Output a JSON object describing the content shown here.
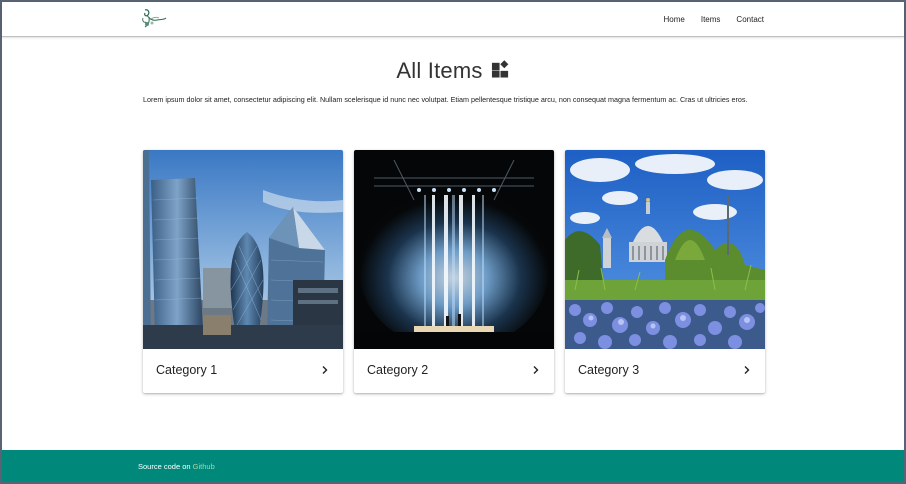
{
  "colors": {
    "footer_bg": "#00897b",
    "link": "#a5d6a7",
    "text": "#222222",
    "border": "#5a6275"
  },
  "header": {
    "logo_icon": "leaf-logo-icon",
    "nav": [
      {
        "label": "Home"
      },
      {
        "label": "Items"
      },
      {
        "label": "Contact"
      }
    ]
  },
  "main": {
    "title": "All Items",
    "title_icon": "widgets-icon",
    "intro": "Lorem ipsum dolor sit amet, consectetur adipiscing elit. Nullam scelerisque id nunc nec volutpat. Etiam pellentesque tristique arcu, non consequat magna fermentum ac. Cras ut ultricies eros.",
    "cards": [
      {
        "label": "Category 1",
        "image": "city-skyscrapers-photo",
        "icon": "chevron-right-icon"
      },
      {
        "label": "Category 2",
        "image": "concert-stage-lights-photo",
        "icon": "chevron-right-icon"
      },
      {
        "label": "Category 3",
        "image": "cathedral-garden-photo",
        "icon": "chevron-right-icon"
      }
    ]
  },
  "footer": {
    "text": "Source code on",
    "link_label": "Github"
  }
}
